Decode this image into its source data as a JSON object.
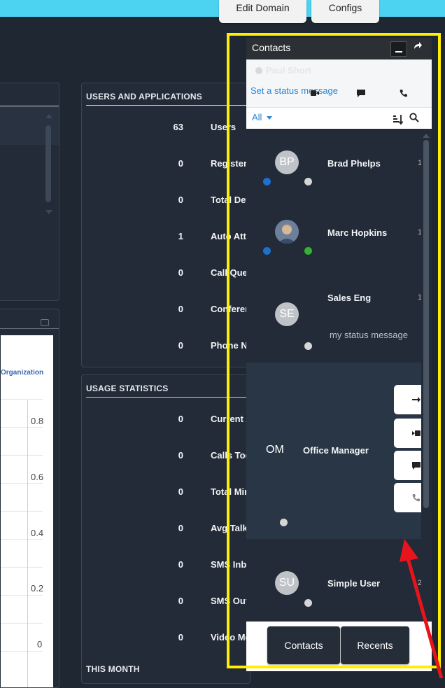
{
  "header": {
    "edit_domain_label": "Edit Domain",
    "configs_label": "Configs"
  },
  "users_panel": {
    "title": "USERS AND APPLICATIONS",
    "rows": [
      {
        "value": "63",
        "label": "Users"
      },
      {
        "value": "0",
        "label": "Registere"
      },
      {
        "value": "0",
        "label": "Total Dev"
      },
      {
        "value": "1",
        "label": "Auto Atte"
      },
      {
        "value": "0",
        "label": "Call Que"
      },
      {
        "value": "0",
        "label": "Conferen"
      },
      {
        "value": "0",
        "label": "Phone N"
      }
    ]
  },
  "usage_panel": {
    "title": "USAGE STATISTICS",
    "rows": [
      {
        "value": "0",
        "label": "Current A"
      },
      {
        "value": "0",
        "label": "Calls Tod"
      },
      {
        "value": "0",
        "label": "Total Min"
      },
      {
        "value": "0",
        "label": "Avg Talk"
      },
      {
        "value": "0",
        "label": "SMS Inbo"
      },
      {
        "value": "0",
        "label": "SMS Out"
      },
      {
        "value": "0",
        "label": "Video Me"
      }
    ],
    "footer_title": "THIS MONTH"
  },
  "chart_panel": {
    "legend_label": "Organization",
    "y_ticks": [
      "0.8",
      "0.6",
      "0.4",
      "0.2",
      "0"
    ]
  },
  "contacts": {
    "title": "Contacts",
    "user_name": "Paul Short",
    "status_link": "Set a status message",
    "filter_label": "All",
    "items": [
      {
        "initials": "BP",
        "name": "Brad Phelps",
        "ext": "1"
      },
      {
        "initials": "",
        "name": "Marc Hopkins",
        "ext": "1"
      },
      {
        "initials": "SE",
        "name": "Sales Eng",
        "ext": "1",
        "status_message": "my status message"
      },
      {
        "initials": "OM",
        "name": "Office Manager",
        "ext": ""
      },
      {
        "initials": "SU",
        "name": "Simple User",
        "ext": "2"
      }
    ],
    "tabs": {
      "contacts_label": "Contacts",
      "recents_label": "Recents"
    }
  },
  "colors": {
    "topbar": "#4dd3f2",
    "highlight": "#ffee00",
    "arrow": "#e8141c",
    "presence_blue": "#1f6fd1",
    "presence_green": "#2fb52f",
    "presence_grey": "#d6d6d6"
  }
}
